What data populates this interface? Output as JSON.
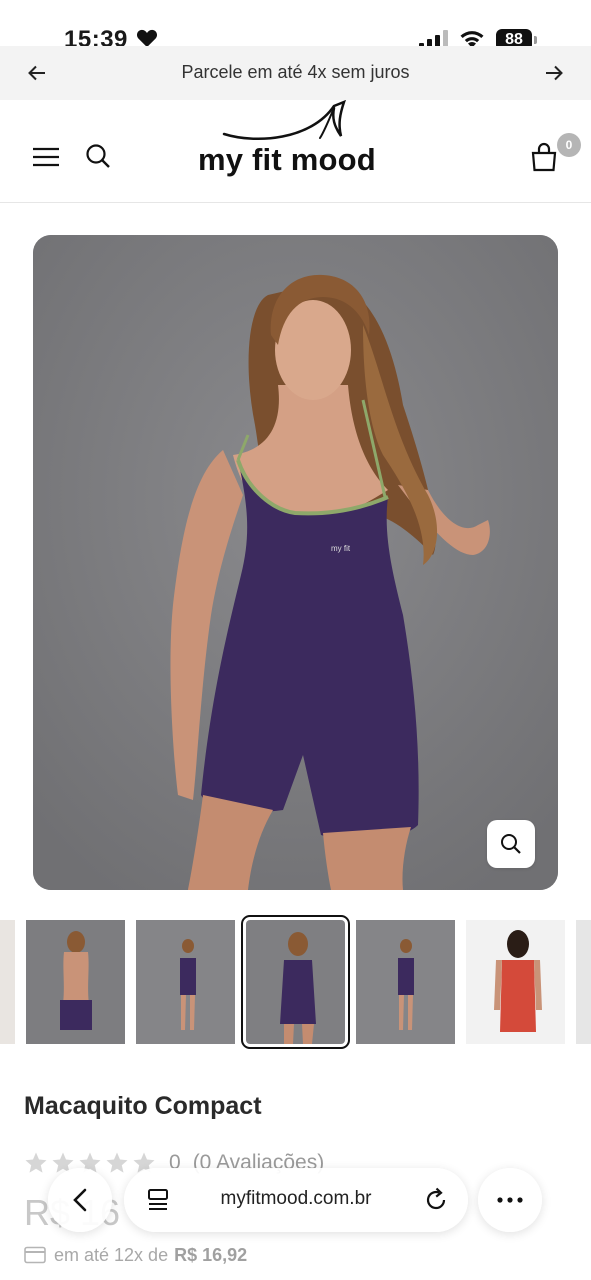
{
  "status_bar": {
    "time": "15:39",
    "battery": "88"
  },
  "promo": {
    "text": "Parcele em até 4x sem juros"
  },
  "header": {
    "logo_text": "my fit mood",
    "cart_count": "0"
  },
  "product": {
    "title": "Macaquito Compact",
    "rating_count": "0",
    "rating_reviews": "(0 Avaliações)",
    "price": "R$ 16",
    "installments_prefix": "em até 12x de",
    "installments_value": "R$ 16,92"
  },
  "browser": {
    "url": "myfitmood.com.br"
  },
  "colors": {
    "garment_purple": "#3c2a5e",
    "background_grey": "#7f7f82",
    "trim_green": "#8ea86a"
  }
}
